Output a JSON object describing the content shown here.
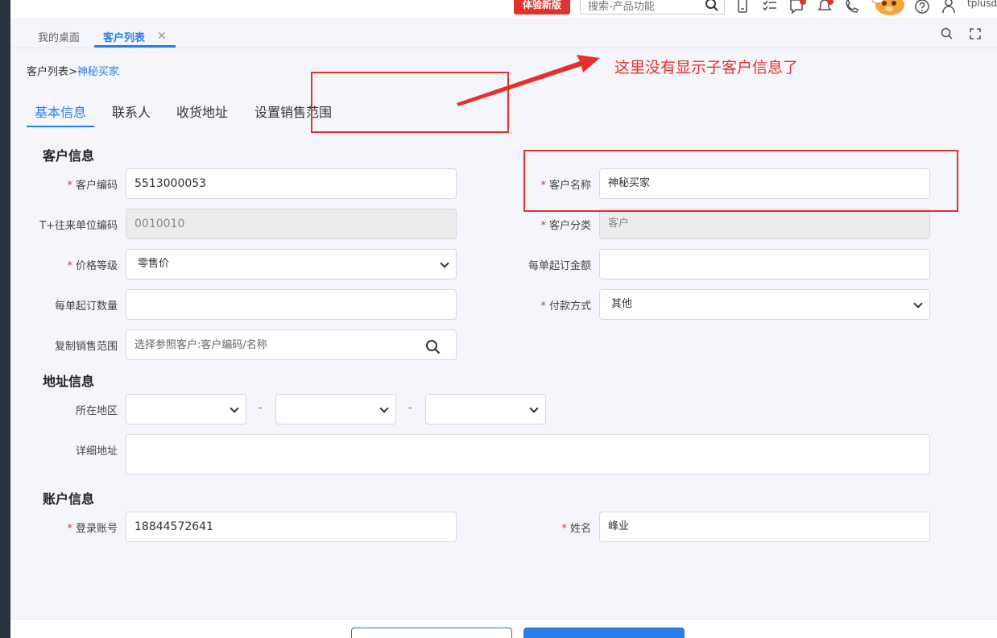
{
  "topbar": {
    "trial_label": "体验新版",
    "search_placeholder": "搜索-产品功能",
    "username": "tplusd."
  },
  "page_tabs": [
    {
      "label": "我的桌面"
    },
    {
      "label": "客户列表"
    }
  ],
  "breadcrumb": {
    "parent": "客户列表>",
    "current": "神秘买家"
  },
  "subtabs": [
    "基本信息",
    "联系人",
    "收货地址",
    "设置销售范围"
  ],
  "sections": {
    "customer": "客户信息",
    "address": "地址信息",
    "account": "账户信息"
  },
  "fields": {
    "customer_code": {
      "label": "客户编码",
      "value": "5513000053"
    },
    "customer_name": {
      "label": "客户名称",
      "value": "神秘买家"
    },
    "tplus_unit_code": {
      "label": "T+往来单位编码",
      "value": "0010010"
    },
    "customer_category": {
      "label": "客户分类",
      "value": "客户"
    },
    "price_level": {
      "label": "价格等级",
      "value": "零售价"
    },
    "min_order_amount": {
      "label": "每单起订金额",
      "value": ""
    },
    "min_order_qty": {
      "label": "每单起订数量",
      "value": ""
    },
    "payment_method": {
      "label": "付款方式",
      "value": "其他"
    },
    "copy_sales_scope": {
      "label": "复制销售范围",
      "placeholder": "选择参照客户:客户编码/名称"
    },
    "region": {
      "label": "所在地区",
      "separator": "-"
    },
    "detail_address": {
      "label": "详细地址",
      "value": ""
    },
    "login_account": {
      "label": "登录账号",
      "value": "18844572641"
    },
    "name": {
      "label": "姓名",
      "value": "峰业"
    }
  },
  "required_mark": "*",
  "annotation": {
    "text": "这里没有显示子客户信息了",
    "color": "#e8302a"
  },
  "colors": {
    "accent": "#2b7de9",
    "danger": "#e0332b",
    "sidebar": "#2c3340"
  }
}
